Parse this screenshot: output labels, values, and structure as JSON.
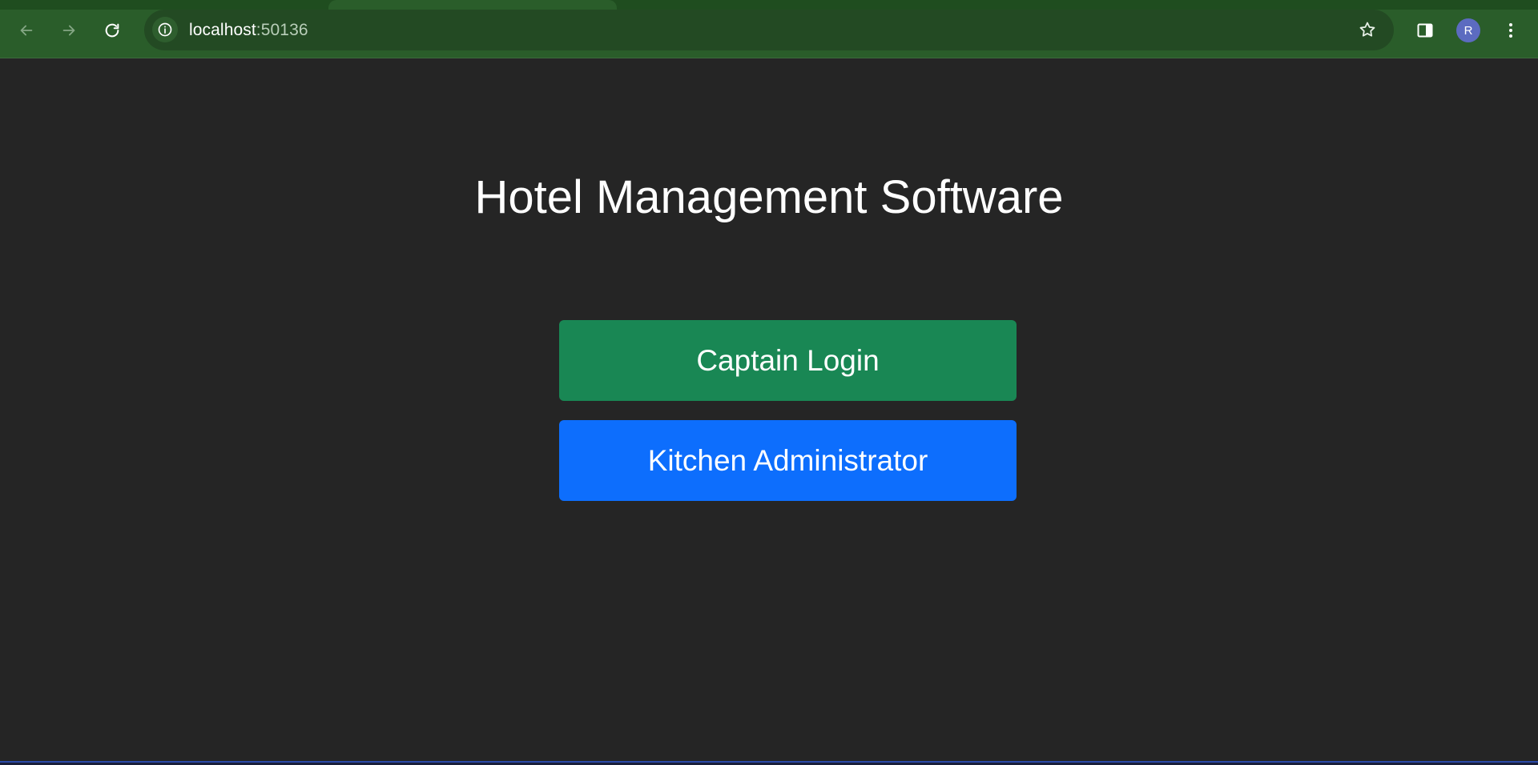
{
  "browser": {
    "url_host": "localhost",
    "url_port": ":50136",
    "profile_initial": "R"
  },
  "page": {
    "title": "Hotel Management Software",
    "buttons": {
      "captain_label": "Captain Login",
      "kitchen_label": "Kitchen Administrator"
    }
  },
  "colors": {
    "chrome": "#2a5d2a",
    "background": "#252525",
    "captain_button": "#198754",
    "kitchen_button": "#0d6efd",
    "avatar": "#5c6bc0"
  },
  "icons": {
    "back": "arrow-left-icon",
    "forward": "arrow-right-icon",
    "reload": "reload-icon",
    "site_info": "info-icon",
    "bookmark": "star-icon",
    "side_panel": "side-panel-icon",
    "menu": "kebab-menu-icon"
  }
}
